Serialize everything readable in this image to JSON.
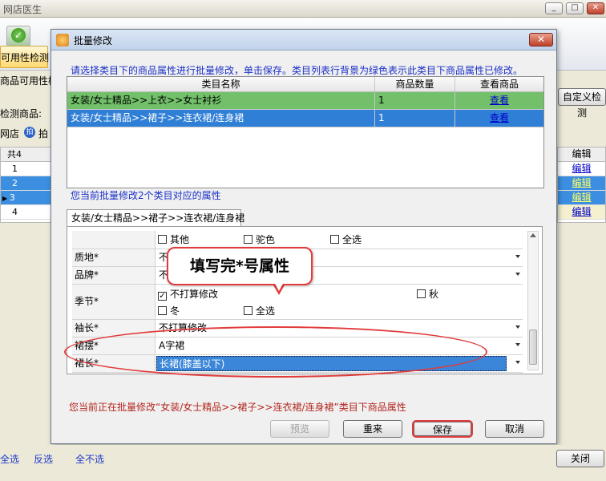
{
  "app": {
    "title": "网店医生"
  },
  "toolbar": {
    "availability_check": "可用性检测"
  },
  "main": {
    "product_availability_label": "商品可用性检",
    "check_product_label": "检测商品:",
    "shop_label": "网店",
    "pai_label": "拍",
    "total_label": "共4",
    "row_numbers": [
      "1",
      "2",
      "3",
      "4"
    ],
    "custom_check_button": "自定义检测",
    "edit_header": "编辑",
    "edit_links": [
      "编辑",
      "编辑",
      "编辑",
      "编辑"
    ]
  },
  "dialog": {
    "title": "批量修改",
    "close_glyph": "✕",
    "instruction": "请选择类目下的商品属性进行批量修改，单击保存。类目列表行背景为绿色表示此类目下商品属性已修改。",
    "table": {
      "headers": [
        "类目名称",
        "商品数量",
        "查看商品"
      ],
      "rows": [
        {
          "category": "女装/女士精品>>上衣>>女士衬衫",
          "count": "1",
          "view": "查看"
        },
        {
          "category": "女装/女士精品>>裙子>>连衣裙/连身裙",
          "count": "1",
          "view": "查看"
        }
      ]
    },
    "section_label": "您当前批量修改2个类目对应的属性",
    "tab_label": "女装/女士精品>>裙子>>连衣裙/连身裙",
    "properties": {
      "color_row": {
        "opt1": "其他",
        "opt2": "驼色",
        "opt3": "全选"
      },
      "material": {
        "label": "质地*",
        "value": "不打算修改"
      },
      "brand": {
        "label": "品牌*",
        "value": "不打算修改"
      },
      "season": {
        "label": "季节*",
        "opt1": "不打算修改",
        "opt2": "秋",
        "opt3": "冬",
        "opt4": "全选",
        "check": "✓"
      },
      "sleeve": {
        "label": "袖长*",
        "value": "不打算修改"
      },
      "hem": {
        "label": "裙摆*",
        "value": "A字裙"
      },
      "skirt_length": {
        "label": "裙长*",
        "value": "长裙(膝盖以下)"
      }
    },
    "status_text": "您当前正在批量修改“女装/女士精品>>裙子>>连衣裙/连身裙”类目下商品属性",
    "buttons": {
      "preview": "预览",
      "reset": "重来",
      "save": "保存",
      "cancel": "取消"
    }
  },
  "annotation": {
    "callout": "填写完*号属性"
  },
  "footer": {
    "select_all": "全选",
    "invert": "反选",
    "select_none": "全不选",
    "close": "关闭"
  },
  "colors": {
    "green_row": "#72c069",
    "blue_row": "#2f7fd6",
    "annotation_red": "#e23b3b"
  }
}
